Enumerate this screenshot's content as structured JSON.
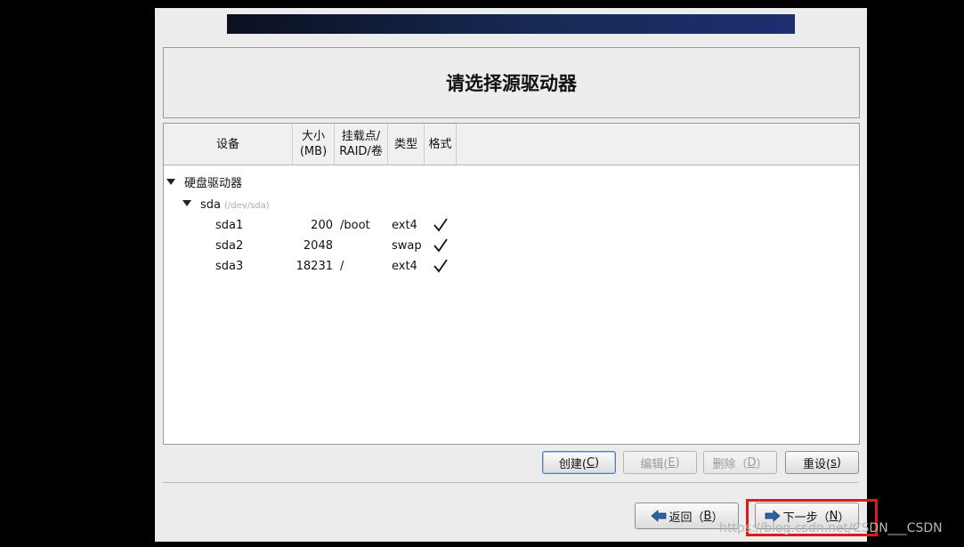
{
  "header": {
    "title": "请选择源驱动器"
  },
  "table": {
    "columns": {
      "device": "设备",
      "size_line1": "大小",
      "size_line2": "(MB)",
      "mount_line1": "挂载点/",
      "mount_line2": "RAID/卷",
      "type": "类型",
      "format": "格式"
    },
    "group": "硬盘驱动器",
    "drive": {
      "name": "sda",
      "path": "(/dev/sda)"
    },
    "partitions": [
      {
        "device": "sda1",
        "size": "200",
        "mount": "/boot",
        "type": "ext4",
        "format": true
      },
      {
        "device": "sda2",
        "size": "2048",
        "mount": "",
        "type": "swap",
        "format": true
      },
      {
        "device": "sda3",
        "size": "18231",
        "mount": "/",
        "type": "ext4",
        "format": true
      }
    ]
  },
  "actions": {
    "create": {
      "label": "创建(",
      "key": "C",
      "suffix": ")"
    },
    "edit": {
      "label": "编辑(",
      "key": "E",
      "suffix": ")"
    },
    "delete": {
      "label": "删除（",
      "key": "D",
      "suffix": "）"
    },
    "reset": {
      "label": "重设(",
      "key": "s",
      "suffix": ")"
    }
  },
  "nav": {
    "back": {
      "label": "返回（",
      "key": "B",
      "suffix": "）"
    },
    "next": {
      "label": "下一步（",
      "key": "N",
      "suffix": "）"
    }
  },
  "watermark": "https://blog.csdn.net/CSDN___CSDN",
  "colors": {
    "highlight": "#e0191a",
    "banner": "#172a55"
  }
}
